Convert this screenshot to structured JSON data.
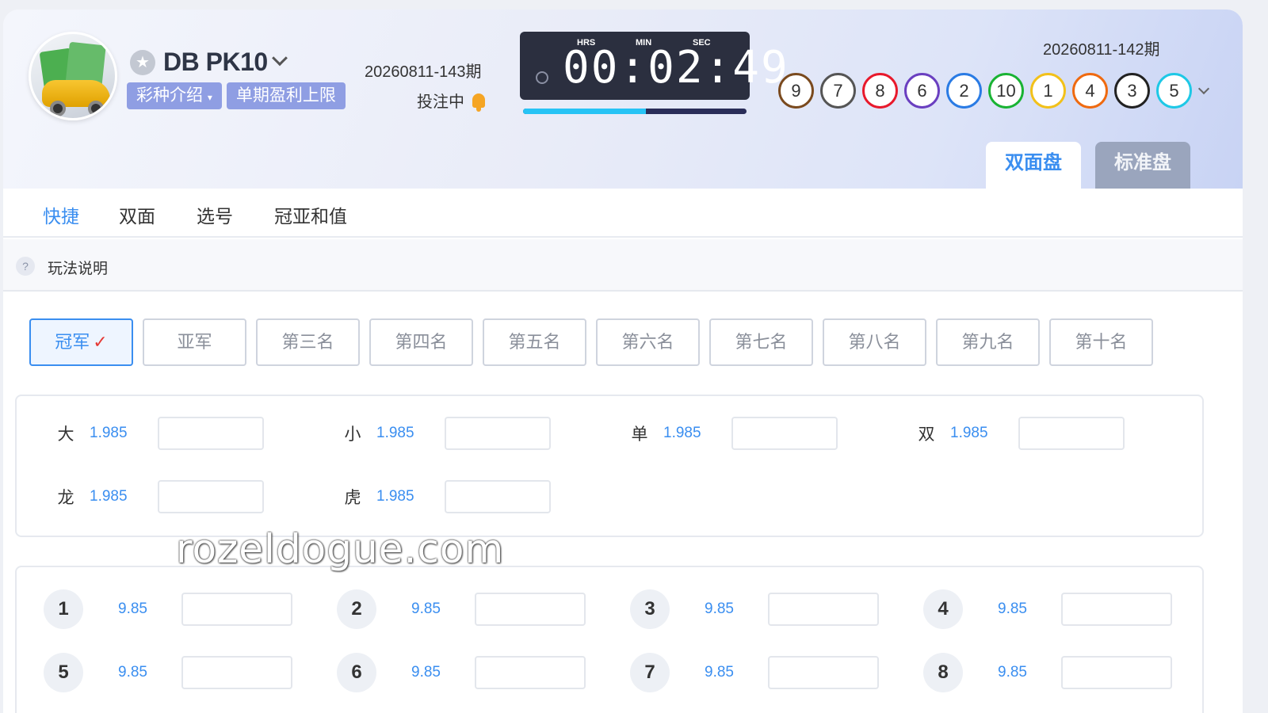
{
  "header": {
    "game_name": "DB PK10",
    "pills": [
      "彩种介绍",
      "单期盈利上限"
    ],
    "current_issue": "20260811-143期",
    "bet_status": "投注中",
    "timer": {
      "hrs_label": "HRS",
      "min_label": "MIN",
      "sec_label": "SEC",
      "value": "00:02:49",
      "progress": 0.55
    },
    "prev_issue": "20260811-142期",
    "balls": [
      {
        "n": "9",
        "color": "#7a4a1e"
      },
      {
        "n": "7",
        "color": "#555555"
      },
      {
        "n": "8",
        "color": "#e8192c"
      },
      {
        "n": "6",
        "color": "#6a3fc0"
      },
      {
        "n": "2",
        "color": "#2a7be4"
      },
      {
        "n": "10",
        "color": "#19b333"
      },
      {
        "n": "1",
        "color": "#f2c11a"
      },
      {
        "n": "4",
        "color": "#ef6a10"
      },
      {
        "n": "3",
        "color": "#222222"
      },
      {
        "n": "5",
        "color": "#1ec8e6"
      }
    ],
    "mode_tabs": [
      "双面盘",
      "标准盘"
    ]
  },
  "nav": {
    "tabs": [
      "快捷",
      "双面",
      "选号",
      "冠亚和值"
    ]
  },
  "help": {
    "label": "玩法说明",
    "icon": "?"
  },
  "ranks": [
    "冠军",
    "亚军",
    "第三名",
    "第四名",
    "第五名",
    "第六名",
    "第七名",
    "第八名",
    "第九名",
    "第十名"
  ],
  "rank_check": "✓",
  "two_side": [
    {
      "label": "大",
      "odds": "1.985"
    },
    {
      "label": "小",
      "odds": "1.985"
    },
    {
      "label": "单",
      "odds": "1.985"
    },
    {
      "label": "双",
      "odds": "1.985"
    },
    {
      "label": "龙",
      "odds": "1.985"
    },
    {
      "label": "虎",
      "odds": "1.985"
    }
  ],
  "numbers": [
    {
      "n": "1",
      "odds": "9.85"
    },
    {
      "n": "2",
      "odds": "9.85"
    },
    {
      "n": "3",
      "odds": "9.85"
    },
    {
      "n": "4",
      "odds": "9.85"
    },
    {
      "n": "5",
      "odds": "9.85"
    },
    {
      "n": "6",
      "odds": "9.85"
    },
    {
      "n": "7",
      "odds": "9.85"
    },
    {
      "n": "8",
      "odds": "9.85"
    }
  ],
  "watermark": "rozeldogue.com"
}
